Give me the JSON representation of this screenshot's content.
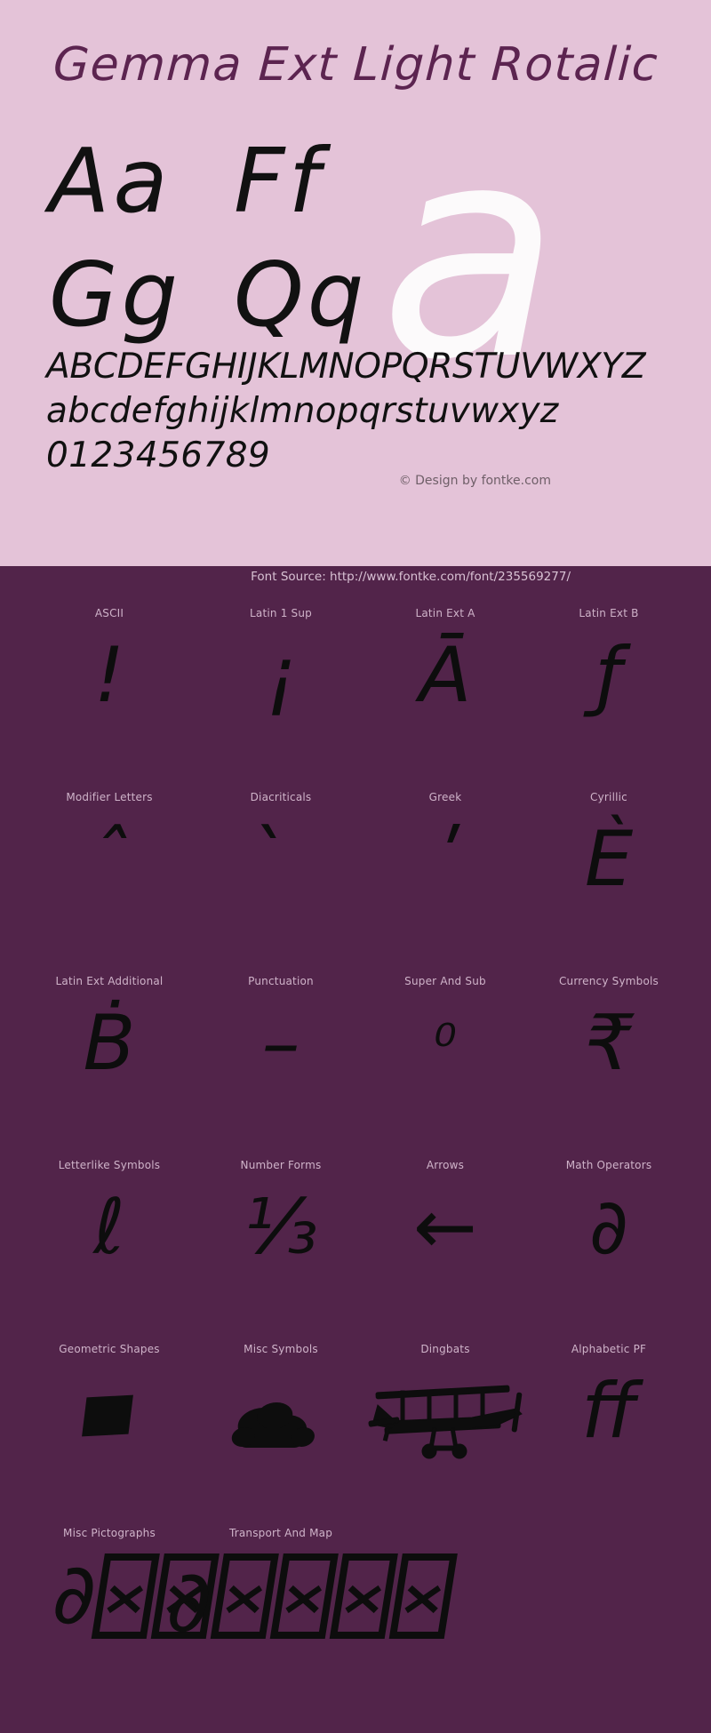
{
  "specimen": {
    "title": "Gemma Ext Light Rotalic",
    "letter_pairs": [
      [
        "Aa",
        "Ff"
      ],
      [
        "Gg",
        "Qq"
      ]
    ],
    "watermark_glyph": "a",
    "uppercase_alphabet": "ABCDEFGHIJKLMNOPQRSTUVWXYZ",
    "lowercase_alphabet": "abcdefghijklmnopqrstuvwxyz",
    "digits": "0123456789",
    "credit": "© Design by fontke.com",
    "source": "Font Source: http://www.fontke.com/font/235569277/",
    "colors": {
      "panel_background": "#e4c3d8",
      "accent_background": "#52244a",
      "title_text": "#5c2450",
      "glyph_text": "#111111",
      "label_text": "#cfb3c9",
      "watermark": "#ffffff"
    }
  },
  "unicode_blocks": {
    "rows": [
      [
        {
          "label": "ASCII",
          "glyph": "!",
          "kind": "text"
        },
        {
          "label": "Latin 1 Sup",
          "glyph": "¡",
          "kind": "text"
        },
        {
          "label": "Latin Ext A",
          "glyph": "Ā",
          "kind": "text"
        },
        {
          "label": "Latin Ext B",
          "glyph": "ƒ",
          "kind": "text"
        }
      ],
      [
        {
          "label": "Modifier Letters",
          "glyph": "ˆ",
          "kind": "text"
        },
        {
          "label": "Diacriticals",
          "glyph": "̀",
          "kind": "text"
        },
        {
          "label": "Greek",
          "glyph": "ʹ",
          "kind": "text"
        },
        {
          "label": "Cyrillic",
          "glyph": "Ѐ",
          "kind": "text"
        }
      ],
      [
        {
          "label": "Latin Ext Additional",
          "glyph": "Ḃ",
          "kind": "text"
        },
        {
          "label": "Punctuation",
          "glyph": "–",
          "kind": "text"
        },
        {
          "label": "Super And Sub",
          "glyph": "⁰",
          "kind": "text"
        },
        {
          "label": "Currency Symbols",
          "glyph": "₹",
          "kind": "text"
        }
      ],
      [
        {
          "label": "Letterlike Symbols",
          "glyph": "ℓ",
          "kind": "text"
        },
        {
          "label": "Number Forms",
          "glyph": "⅓",
          "kind": "text"
        },
        {
          "label": "Arrows",
          "glyph": "←",
          "kind": "text"
        },
        {
          "label": "Math Operators",
          "glyph": "∂",
          "kind": "text"
        }
      ],
      [
        {
          "label": "Geometric Shapes",
          "glyph": "■",
          "kind": "square"
        },
        {
          "label": "Misc Symbols",
          "glyph": "☁",
          "kind": "cloud"
        },
        {
          "label": "Dingbats",
          "glyph": "✈",
          "kind": "plane"
        },
        {
          "label": "Alphabetic PF",
          "glyph": "ﬀ",
          "kind": "text"
        }
      ],
      [
        {
          "label": "Misc Pictographs",
          "glyph": "∂",
          "kind": "tofu-strip"
        },
        {
          "label": "Transport And Map",
          "glyph": "□",
          "kind": "tofu-strip-cont"
        }
      ]
    ]
  }
}
